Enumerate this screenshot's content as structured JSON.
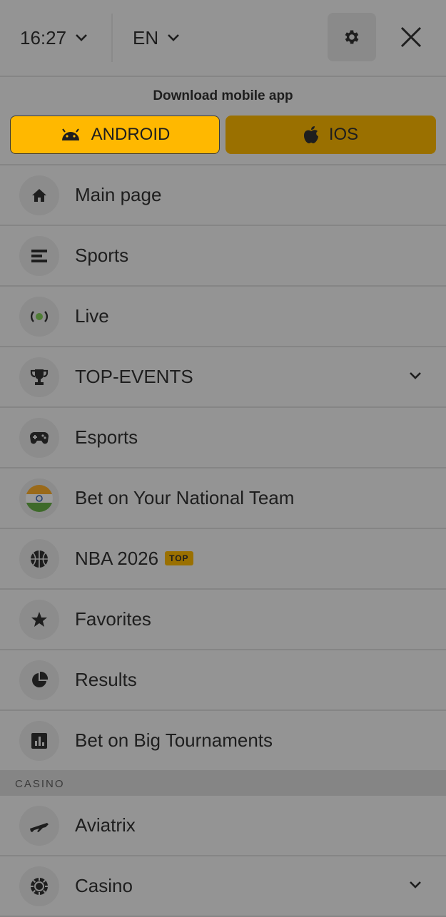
{
  "header": {
    "time": "16:27",
    "language": "EN"
  },
  "download": {
    "title": "Download mobile app",
    "android_label": "ANDROID",
    "ios_label": "IOS"
  },
  "menu": [
    {
      "label": "Main page",
      "icon": "home-icon"
    },
    {
      "label": "Sports",
      "icon": "list-icon"
    },
    {
      "label": "Live",
      "icon": "live-icon"
    },
    {
      "label": "TOP-EVENTS",
      "icon": "trophy-icon"
    },
    {
      "label": "Esports",
      "icon": "gamepad-icon"
    },
    {
      "label": "Bet on Your National Team",
      "icon": "india-flag-icon"
    },
    {
      "label": "NBA 2026",
      "icon": "basketball-icon",
      "badge": "TOP"
    },
    {
      "label": "Favorites",
      "icon": "star-icon"
    },
    {
      "label": "Results",
      "icon": "pie-chart-icon"
    },
    {
      "label": "Bet on Big Tournaments",
      "icon": "bar-chart-icon"
    }
  ],
  "casino_section": {
    "title": "CASINO",
    "items": [
      {
        "label": "Aviatrix",
        "icon": "airplane-icon"
      },
      {
        "label": "Casino",
        "icon": "casino-chip-icon"
      }
    ]
  },
  "colors": {
    "android_button": "#ffb800",
    "ios_button": "#9a7000",
    "background": "#949494"
  }
}
